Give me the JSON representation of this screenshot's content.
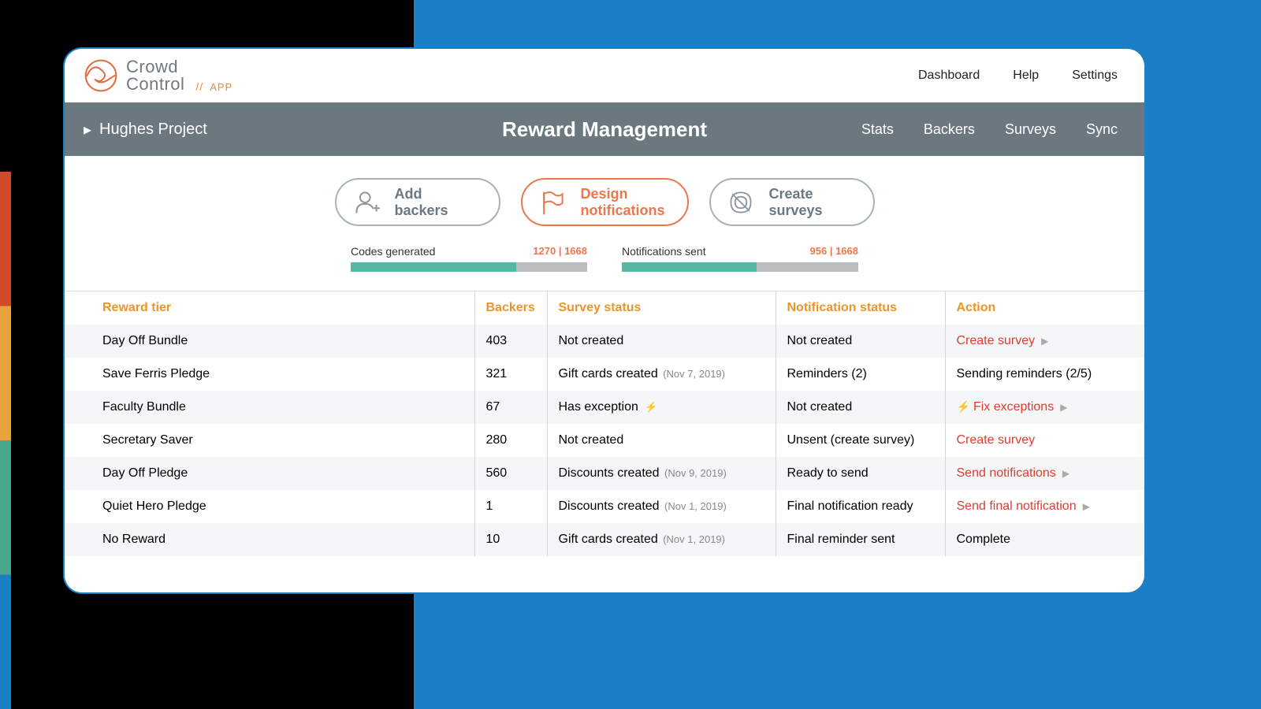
{
  "brand": {
    "name_line1": "Crowd",
    "name_line2": "Control",
    "app_slash": "//",
    "app_label": "APP"
  },
  "topnav": {
    "dashboard": "Dashboard",
    "help": "Help",
    "settings": "Settings"
  },
  "subhead": {
    "project": "Hughes Project",
    "title": "Reward Management",
    "nav": {
      "stats": "Stats",
      "backers": "Backers",
      "surveys": "Surveys",
      "sync": "Sync"
    }
  },
  "pills": {
    "add_backers_l1": "Add",
    "add_backers_l2": "backers",
    "design_notif_l1": "Design",
    "design_notif_l2": "notifications",
    "create_surveys_l1": "Create",
    "create_surveys_l2": "surveys"
  },
  "progress": {
    "codes": {
      "label": "Codes generated",
      "count": "1270 | 1668",
      "pct": 70
    },
    "notif": {
      "label": "Notifications sent",
      "count": "956 | 1668",
      "pct": 57
    }
  },
  "columns": {
    "tier": "Reward tier",
    "backers": "Backers",
    "survey": "Survey status",
    "notif": "Notification status",
    "action": "Action"
  },
  "rows": [
    {
      "tier": "Day Off Bundle",
      "backers": "403",
      "survey": "Not created",
      "survey_date": "",
      "notif": "Not created",
      "action": "Create survey",
      "action_red": true,
      "chevron": true
    },
    {
      "tier": "Save Ferris Pledge",
      "backers": "321",
      "survey": "Gift cards created",
      "survey_date": "(Nov 7, 2019)",
      "notif": "Reminders (2)",
      "action": "Sending reminders (2/5)",
      "action_red": false,
      "chevron": false
    },
    {
      "tier": "Faculty Bundle",
      "backers": "67",
      "survey": "Has exception",
      "survey_date": "",
      "survey_bolt": true,
      "notif": "Not created",
      "action": "Fix exceptions",
      "action_red": true,
      "action_bolt": true,
      "chevron": true
    },
    {
      "tier": "Secretary Saver",
      "backers": "280",
      "survey": "Not created",
      "survey_date": "",
      "notif": "Unsent (create survey)",
      "action": "Create survey",
      "action_red": true,
      "chevron": false
    },
    {
      "tier": "Day Off Pledge",
      "backers": "560",
      "survey": "Discounts created",
      "survey_date": "(Nov 9, 2019)",
      "notif": "Ready to send",
      "action": "Send notifications",
      "action_red": true,
      "chevron": true
    },
    {
      "tier": "Quiet Hero Pledge",
      "backers": "1",
      "survey": "Discounts created",
      "survey_date": "(Nov 1, 2019)",
      "notif": "Final notification ready",
      "action": "Send final notification",
      "action_red": true,
      "chevron": true
    },
    {
      "tier": "No Reward",
      "backers": "10",
      "survey": "Gift cards created",
      "survey_date": "(Nov 1, 2019)",
      "notif": "Final reminder sent",
      "action": "Complete",
      "action_red": false,
      "chevron": false
    }
  ]
}
